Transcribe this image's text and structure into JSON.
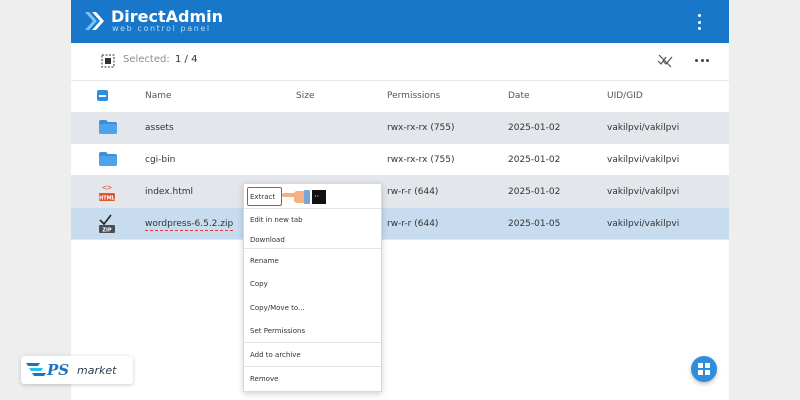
{
  "app": {
    "brand_name": "DirectAdmin",
    "brand_tagline": "web control panel",
    "menu_icon": "kebab-icon"
  },
  "toolbar": {
    "selected_label": "Selected:",
    "selected_count": "1 / 4",
    "select_icon": "select-all-icon",
    "deselect_icon": "deselect-icon",
    "more_icon": "more-icon"
  },
  "table": {
    "columns": [
      "Name",
      "Size",
      "Permissions",
      "Date",
      "UID/GID"
    ],
    "rows": [
      {
        "name": "assets",
        "size": "",
        "permissions": "rwx-rx-rx (755)",
        "date": "2025-01-02",
        "uid_gid": "vakilpvi/vakilpvi",
        "icon": "folder-icon"
      },
      {
        "name": "cgi-bin",
        "size": "",
        "permissions": "rwx-rx-rx (755)",
        "date": "2025-01-02",
        "uid_gid": "vakilpvi/vakilpvi",
        "icon": "folder-icon"
      },
      {
        "name": "index.html",
        "size": "",
        "permissions": "rw-r-r (644)",
        "date": "2025-01-02",
        "uid_gid": "vakilpvi/vakilpvi",
        "icon": "html-file-icon",
        "icon_text": "HTML"
      },
      {
        "name": "wordpress-6.5.2.zip",
        "size": "",
        "permissions": "rw-r-r (644)",
        "date": "2025-01-05",
        "uid_gid": "vakilpvi/vakilpvi",
        "icon": "zip-file-icon",
        "icon_text": "ZIP",
        "selected": true
      }
    ]
  },
  "context_menu": {
    "items": [
      "Extract",
      "Edit in new tab",
      "Download",
      "Rename",
      "Copy",
      "Copy/Move to...",
      "Set Permissions",
      "Add to archive",
      "Remove"
    ]
  },
  "fab_icon": "layout-grid-icon",
  "watermark": {
    "text_main": "PS",
    "text_sub": "market"
  },
  "colors": {
    "header": "#1877c9",
    "row_grey": "#e3e6ea",
    "row_selected": "#c7dcef",
    "accent": "#2b8ee0",
    "highlight_red": "#e53935"
  }
}
